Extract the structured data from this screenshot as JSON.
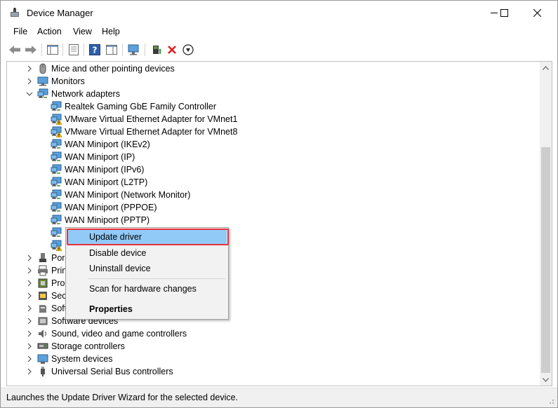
{
  "window": {
    "title": "Device Manager",
    "minimize_icon": "minimize-icon",
    "maximize_icon": "maximize-icon",
    "close_icon": "close-icon"
  },
  "menu": [
    "File",
    "Action",
    "View",
    "Help"
  ],
  "toolbar": {
    "icons": [
      "back-arrow-icon",
      "forward-arrow-icon",
      "show-hide-console-tree-icon",
      "properties-icon",
      "help-icon",
      "show-action-pane-icon",
      "scan-hardware-icon",
      "update-driver-icon",
      "uninstall-device-icon",
      "disable-device-icon"
    ]
  },
  "tree": {
    "rows": [
      {
        "label": "Mice and other pointing devices",
        "expanded": false,
        "icon": "mouse-icon",
        "level": 0
      },
      {
        "label": "Monitors",
        "expanded": false,
        "icon": "monitor-icon",
        "level": 0
      },
      {
        "label": "Network adapters",
        "expanded": true,
        "icon": "network-adapter-icon",
        "level": 0
      },
      {
        "label": "Realtek Gaming GbE Family Controller",
        "icon": "network-adapter-icon",
        "level": 1
      },
      {
        "label": "VMware Virtual Ethernet Adapter for VMnet1",
        "icon": "network-adapter-warning-icon",
        "level": 1
      },
      {
        "label": "VMware Virtual Ethernet Adapter for VMnet8",
        "icon": "network-adapter-warning-icon",
        "level": 1
      },
      {
        "label": "WAN Miniport (IKEv2)",
        "icon": "network-adapter-icon",
        "level": 1
      },
      {
        "label": "WAN Miniport (IP)",
        "icon": "network-adapter-icon",
        "level": 1
      },
      {
        "label": "WAN Miniport (IPv6)",
        "icon": "network-adapter-icon",
        "level": 1
      },
      {
        "label": "WAN Miniport (L2TP)",
        "icon": "network-adapter-icon",
        "level": 1
      },
      {
        "label": "WAN Miniport (Network Monitor)",
        "icon": "network-adapter-icon",
        "level": 1
      },
      {
        "label": "WAN Miniport (PPPOE)",
        "icon": "network-adapter-icon",
        "level": 1
      },
      {
        "label": "WAN Miniport (PPTP)",
        "icon": "network-adapter-icon",
        "level": 1
      },
      {
        "label": "",
        "icon": "network-adapter-icon",
        "level": 1
      },
      {
        "label": "",
        "icon": "network-adapter-warning-icon",
        "level": 1
      },
      {
        "label": "Por",
        "expanded": false,
        "icon": "port-icon",
        "level": 0
      },
      {
        "label": "Prin",
        "expanded": false,
        "icon": "printer-icon",
        "level": 0
      },
      {
        "label": "Pro",
        "expanded": false,
        "icon": "processor-icon",
        "level": 0
      },
      {
        "label": "Sec",
        "expanded": false,
        "icon": "security-icon",
        "level": 0
      },
      {
        "label": "Soft",
        "expanded": false,
        "icon": "software-component-icon",
        "level": 0
      },
      {
        "label": "Software devices",
        "expanded": false,
        "icon": "software-device-icon",
        "level": 0
      },
      {
        "label": "Sound, video and game controllers",
        "expanded": false,
        "icon": "speaker-icon",
        "level": 0
      },
      {
        "label": "Storage controllers",
        "expanded": false,
        "icon": "storage-controller-icon",
        "level": 0
      },
      {
        "label": "System devices",
        "expanded": false,
        "icon": "system-device-icon",
        "level": 0
      },
      {
        "label": "Universal Serial Bus controllers",
        "expanded": false,
        "icon": "usb-icon",
        "level": 0
      }
    ]
  },
  "context_menu": {
    "items": [
      {
        "label": "Update driver",
        "highlighted": true
      },
      {
        "label": "Disable device"
      },
      {
        "label": "Uninstall device"
      },
      {
        "label": "Scan for hardware changes"
      },
      {
        "label": "Properties",
        "bold": true
      }
    ]
  },
  "status": {
    "text": "Launches the Update Driver Wizard for the selected device."
  },
  "colors": {
    "highlight": "#91c9f7",
    "highlight_border": "#e8313a",
    "uninstall_red": "#e02020",
    "update_green": "#2e9e3e"
  }
}
